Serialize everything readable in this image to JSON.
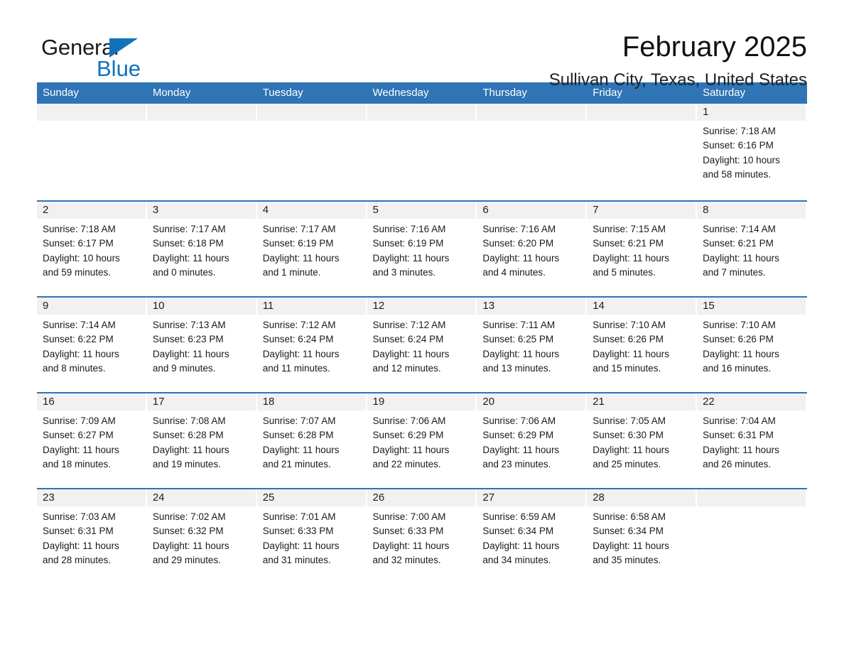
{
  "brand": {
    "name_part1": "General",
    "name_part2": "Blue",
    "triangle_color": "#1271bb",
    "text_color": "#1b1b1b"
  },
  "header": {
    "month_title": "February 2025",
    "location": "Sullivan City, Texas, United States"
  },
  "theme": {
    "header_blue": "#2f74b5",
    "row_rule_blue": "#2f74b5",
    "daynum_band": "#f1f1f1",
    "page_background": "#ffffff",
    "body_text": "#1a1a1a"
  },
  "calendar": {
    "weekday_headers": [
      "Sunday",
      "Monday",
      "Tuesday",
      "Wednesday",
      "Thursday",
      "Friday",
      "Saturday"
    ],
    "weeks": [
      [
        {
          "day": "",
          "empty": true
        },
        {
          "day": "",
          "empty": true
        },
        {
          "day": "",
          "empty": true
        },
        {
          "day": "",
          "empty": true
        },
        {
          "day": "",
          "empty": true
        },
        {
          "day": "",
          "empty": true
        },
        {
          "day": "1",
          "sunrise": "Sunrise: 7:18 AM",
          "sunset": "Sunset: 6:16 PM",
          "daylight_line1": "Daylight: 10 hours",
          "daylight_line2": "and 58 minutes."
        }
      ],
      [
        {
          "day": "2",
          "sunrise": "Sunrise: 7:18 AM",
          "sunset": "Sunset: 6:17 PM",
          "daylight_line1": "Daylight: 10 hours",
          "daylight_line2": "and 59 minutes."
        },
        {
          "day": "3",
          "sunrise": "Sunrise: 7:17 AM",
          "sunset": "Sunset: 6:18 PM",
          "daylight_line1": "Daylight: 11 hours",
          "daylight_line2": "and 0 minutes."
        },
        {
          "day": "4",
          "sunrise": "Sunrise: 7:17 AM",
          "sunset": "Sunset: 6:19 PM",
          "daylight_line1": "Daylight: 11 hours",
          "daylight_line2": "and 1 minute."
        },
        {
          "day": "5",
          "sunrise": "Sunrise: 7:16 AM",
          "sunset": "Sunset: 6:19 PM",
          "daylight_line1": "Daylight: 11 hours",
          "daylight_line2": "and 3 minutes."
        },
        {
          "day": "6",
          "sunrise": "Sunrise: 7:16 AM",
          "sunset": "Sunset: 6:20 PM",
          "daylight_line1": "Daylight: 11 hours",
          "daylight_line2": "and 4 minutes."
        },
        {
          "day": "7",
          "sunrise": "Sunrise: 7:15 AM",
          "sunset": "Sunset: 6:21 PM",
          "daylight_line1": "Daylight: 11 hours",
          "daylight_line2": "and 5 minutes."
        },
        {
          "day": "8",
          "sunrise": "Sunrise: 7:14 AM",
          "sunset": "Sunset: 6:21 PM",
          "daylight_line1": "Daylight: 11 hours",
          "daylight_line2": "and 7 minutes."
        }
      ],
      [
        {
          "day": "9",
          "sunrise": "Sunrise: 7:14 AM",
          "sunset": "Sunset: 6:22 PM",
          "daylight_line1": "Daylight: 11 hours",
          "daylight_line2": "and 8 minutes."
        },
        {
          "day": "10",
          "sunrise": "Sunrise: 7:13 AM",
          "sunset": "Sunset: 6:23 PM",
          "daylight_line1": "Daylight: 11 hours",
          "daylight_line2": "and 9 minutes."
        },
        {
          "day": "11",
          "sunrise": "Sunrise: 7:12 AM",
          "sunset": "Sunset: 6:24 PM",
          "daylight_line1": "Daylight: 11 hours",
          "daylight_line2": "and 11 minutes."
        },
        {
          "day": "12",
          "sunrise": "Sunrise: 7:12 AM",
          "sunset": "Sunset: 6:24 PM",
          "daylight_line1": "Daylight: 11 hours",
          "daylight_line2": "and 12 minutes."
        },
        {
          "day": "13",
          "sunrise": "Sunrise: 7:11 AM",
          "sunset": "Sunset: 6:25 PM",
          "daylight_line1": "Daylight: 11 hours",
          "daylight_line2": "and 13 minutes."
        },
        {
          "day": "14",
          "sunrise": "Sunrise: 7:10 AM",
          "sunset": "Sunset: 6:26 PM",
          "daylight_line1": "Daylight: 11 hours",
          "daylight_line2": "and 15 minutes."
        },
        {
          "day": "15",
          "sunrise": "Sunrise: 7:10 AM",
          "sunset": "Sunset: 6:26 PM",
          "daylight_line1": "Daylight: 11 hours",
          "daylight_line2": "and 16 minutes."
        }
      ],
      [
        {
          "day": "16",
          "sunrise": "Sunrise: 7:09 AM",
          "sunset": "Sunset: 6:27 PM",
          "daylight_line1": "Daylight: 11 hours",
          "daylight_line2": "and 18 minutes."
        },
        {
          "day": "17",
          "sunrise": "Sunrise: 7:08 AM",
          "sunset": "Sunset: 6:28 PM",
          "daylight_line1": "Daylight: 11 hours",
          "daylight_line2": "and 19 minutes."
        },
        {
          "day": "18",
          "sunrise": "Sunrise: 7:07 AM",
          "sunset": "Sunset: 6:28 PM",
          "daylight_line1": "Daylight: 11 hours",
          "daylight_line2": "and 21 minutes."
        },
        {
          "day": "19",
          "sunrise": "Sunrise: 7:06 AM",
          "sunset": "Sunset: 6:29 PM",
          "daylight_line1": "Daylight: 11 hours",
          "daylight_line2": "and 22 minutes."
        },
        {
          "day": "20",
          "sunrise": "Sunrise: 7:06 AM",
          "sunset": "Sunset: 6:29 PM",
          "daylight_line1": "Daylight: 11 hours",
          "daylight_line2": "and 23 minutes."
        },
        {
          "day": "21",
          "sunrise": "Sunrise: 7:05 AM",
          "sunset": "Sunset: 6:30 PM",
          "daylight_line1": "Daylight: 11 hours",
          "daylight_line2": "and 25 minutes."
        },
        {
          "day": "22",
          "sunrise": "Sunrise: 7:04 AM",
          "sunset": "Sunset: 6:31 PM",
          "daylight_line1": "Daylight: 11 hours",
          "daylight_line2": "and 26 minutes."
        }
      ],
      [
        {
          "day": "23",
          "sunrise": "Sunrise: 7:03 AM",
          "sunset": "Sunset: 6:31 PM",
          "daylight_line1": "Daylight: 11 hours",
          "daylight_line2": "and 28 minutes."
        },
        {
          "day": "24",
          "sunrise": "Sunrise: 7:02 AM",
          "sunset": "Sunset: 6:32 PM",
          "daylight_line1": "Daylight: 11 hours",
          "daylight_line2": "and 29 minutes."
        },
        {
          "day": "25",
          "sunrise": "Sunrise: 7:01 AM",
          "sunset": "Sunset: 6:33 PM",
          "daylight_line1": "Daylight: 11 hours",
          "daylight_line2": "and 31 minutes."
        },
        {
          "day": "26",
          "sunrise": "Sunrise: 7:00 AM",
          "sunset": "Sunset: 6:33 PM",
          "daylight_line1": "Daylight: 11 hours",
          "daylight_line2": "and 32 minutes."
        },
        {
          "day": "27",
          "sunrise": "Sunrise: 6:59 AM",
          "sunset": "Sunset: 6:34 PM",
          "daylight_line1": "Daylight: 11 hours",
          "daylight_line2": "and 34 minutes."
        },
        {
          "day": "28",
          "sunrise": "Sunrise: 6:58 AM",
          "sunset": "Sunset: 6:34 PM",
          "daylight_line1": "Daylight: 11 hours",
          "daylight_line2": "and 35 minutes."
        },
        {
          "day": "",
          "empty": true
        }
      ]
    ]
  }
}
